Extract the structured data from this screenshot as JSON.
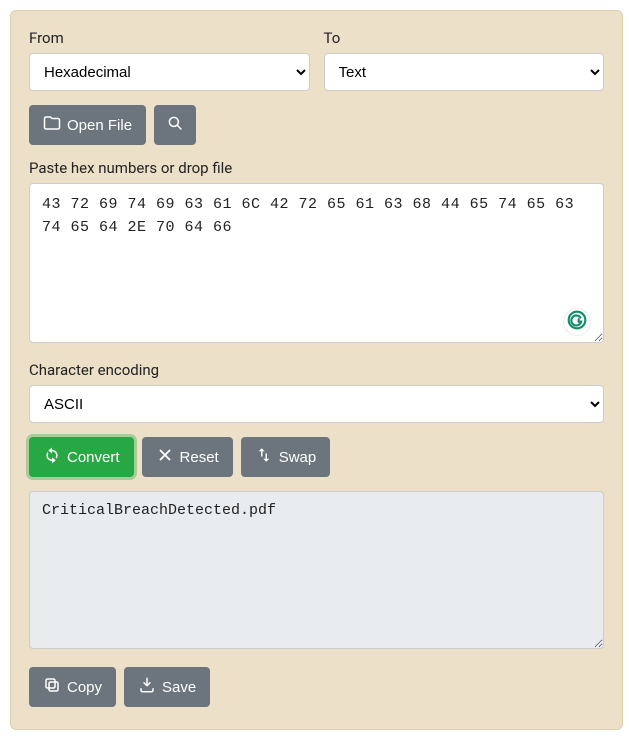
{
  "labels": {
    "from": "From",
    "to": "To",
    "paste": "Paste hex numbers or drop file",
    "encoding": "Character encoding"
  },
  "selects": {
    "from_value": "Hexadecimal",
    "to_value": "Text",
    "encoding_value": "ASCII"
  },
  "buttons": {
    "open_file": "Open File",
    "convert": "Convert",
    "reset": "Reset",
    "swap": "Swap",
    "copy": "Copy",
    "save": "Save"
  },
  "input_value": "43 72 69 74 69 63 61 6C 42 72 65 61 63 68 44 65 74 65 63 74 65 64 2E 70 64 66",
  "output_value": "CriticalBreachDetected.pdf"
}
